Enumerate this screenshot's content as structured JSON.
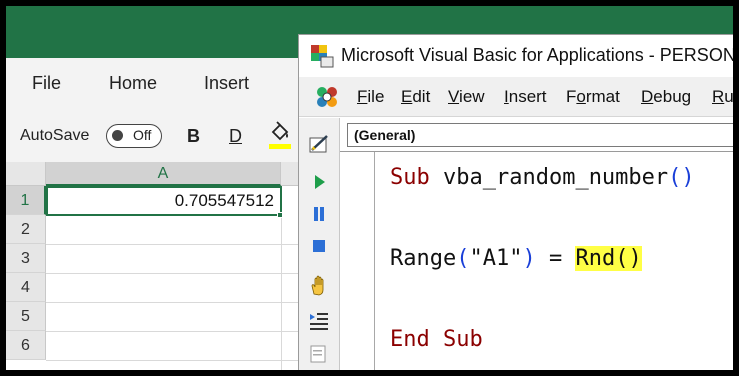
{
  "excel": {
    "menu_tabs": [
      "File",
      "Home",
      "Insert"
    ],
    "autosave_label": "AutoSave",
    "autosave_state": "Off",
    "bold_label": "B",
    "underline_label": "D",
    "column_headers": [
      "A"
    ],
    "row_headers": [
      "1",
      "2",
      "3",
      "4",
      "5",
      "6"
    ],
    "cell_a1_value": "0.705547512",
    "accent_color": "#217346",
    "fill_color_bar": "#ffff00"
  },
  "vba": {
    "title": "Microsoft Visual Basic for Applications - PERSONAL",
    "menu": [
      {
        "m": "F",
        "r": "ile"
      },
      {
        "m": "E",
        "r": "dit"
      },
      {
        "m": "V",
        "r": "iew"
      },
      {
        "m": "I",
        "r": "nsert"
      },
      {
        "m": "o",
        "l": "F",
        "r": "rmat"
      },
      {
        "m": "D",
        "r": "ebug"
      },
      {
        "m": "R",
        "r": "un"
      }
    ],
    "object_combo": "(General)",
    "code": {
      "line1_keyword": "Sub",
      "line1_name": " vba_random_number",
      "line1_parens": "()",
      "line3_range": "Range",
      "line3_open": "(",
      "line3_arg": "\"A1\"",
      "line3_close": ")",
      "line3_eq": " = ",
      "line3_func": "Rnd",
      "line3_func_parens": "()",
      "line5": "End Sub"
    },
    "toolbar_icons": [
      "design-mode-icon",
      "run-icon",
      "break-icon",
      "reset-icon",
      "hand-icon",
      "indent-icon",
      "outdent-icon"
    ],
    "keyword_color": "#8b0000",
    "highlight_color": "#ffff45"
  }
}
